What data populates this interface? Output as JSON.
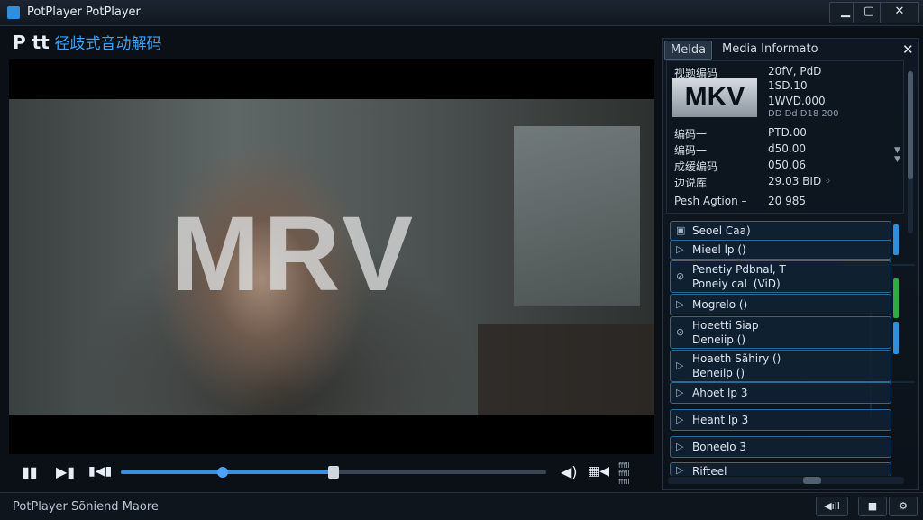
{
  "window": {
    "title": "PotPlayer PotPlayer",
    "min": "▁",
    "max": "▢",
    "close": "✕"
  },
  "header": {
    "logo": "P tt",
    "subtitle": "径歧式音动解码"
  },
  "video": {
    "overlay_text": "MRV"
  },
  "controls": {
    "play_icon": "▮▮",
    "next_icon": "▶▮",
    "frame_icon": "▮◀▮",
    "volume_icon": "◀)",
    "settings_icon": "▦◀",
    "seek_buffered": 0.5,
    "seek_position": 0.24,
    "info_line1": "fffll",
    "info_line2": "fffll",
    "info_line3": "fffll"
  },
  "status": {
    "text": "PotPlayer Sõniend Maore",
    "btn_a": "◀ıll",
    "btn_b": "■",
    "btn_c": "⚙"
  },
  "panel": {
    "tab_active": "Melda",
    "tab_other": "Media Informato",
    "close": "✕",
    "badge": "MKV",
    "rows": [
      {
        "label": "视题编码",
        "value": "20fV, PdD"
      },
      {
        "label": "",
        "value": "1SD.10"
      },
      {
        "label": "",
        "value": "1WVD.000"
      },
      {
        "label": "",
        "value": "DD Dd D18 200"
      },
      {
        "label": "编码一",
        "value": "PTD.00"
      },
      {
        "label": "编码一",
        "value": "d50.00"
      },
      {
        "label": "成缓编码",
        "value": "050.06"
      },
      {
        "label": "边说库",
        "value": "29.03 BID ◦"
      },
      {
        "label": "Pesh Agtion –",
        "value": "20 985"
      }
    ],
    "list": [
      {
        "glyph": "▣",
        "lines": [
          "Seoel Caa)"
        ]
      },
      {
        "glyph": "▷",
        "lines": [
          "Mieel lp ()"
        ]
      },
      {
        "glyph": "⊘",
        "lines": [
          "Penetiy Pdbnal, T",
          "Poneiy caL (ViD)"
        ]
      },
      {
        "glyph": "▷",
        "lines": [
          "Mogrelo ()"
        ]
      },
      {
        "glyph": "⊘",
        "lines": [
          "Hoeetti Siap",
          "Deneiip ()"
        ]
      },
      {
        "glyph": "▷",
        "lines": [
          "Hoaeth Sãhiry ()",
          "Beneilp ()"
        ]
      },
      {
        "glyph": "▷",
        "lines": [
          "Ahoet lp 3"
        ]
      },
      {
        "glyph": "▷",
        "lines": [
          "Heant lp 3"
        ]
      },
      {
        "glyph": "▷",
        "lines": [
          "Boneelo 3"
        ]
      },
      {
        "glyph": "▷",
        "lines": [
          "Rifteel"
        ]
      }
    ],
    "accent_blue": "#2f8fdc",
    "accent_green": "#2faa4a"
  }
}
